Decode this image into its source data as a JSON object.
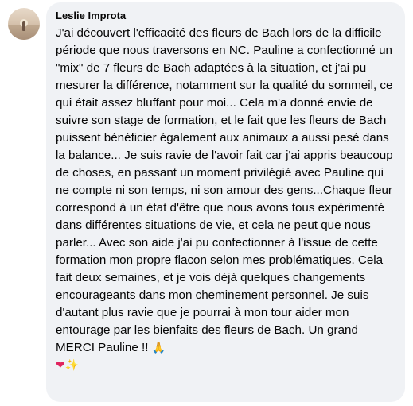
{
  "comment": {
    "author": "Leslie Improta",
    "text": "J'ai découvert l'efficacité des fleurs de Bach lors de la difficile période que nous traversons en NC. Pauline a confectionné un \"mix\" de 7 fleurs de Bach adaptées à la situation, et j'ai pu mesurer la différence, notamment sur la qualité du sommeil, ce qui était assez bluffant pour moi... Cela m'a donné envie de suivre son stage de formation, et le fait que les fleurs de Bach puissent bénéficier également aux animaux a aussi pesé dans la balance... Je suis ravie de l'avoir fait car j'ai appris beaucoup de choses, en passant un moment privilégié avec Pauline qui ne compte ni son temps, ni son amour des gens...Chaque fleur correspond à un état d'être que nous avons tous expérimenté dans différentes situations de vie, et cela ne peut que nous parler... Avec son aide j'ai pu confectionner à l'issue de cette formation mon propre flacon selon mes problématiques. Cela fait deux semaines, et je vois déjà quelques changements encourageants dans mon cheminement personnel. Je suis d'autant plus ravie que je pourrai à mon tour aider mon entourage par les bienfaits des fleurs de Bach. Un grand MERCI Pauline !!",
    "emojis": {
      "pray": "🙏",
      "heart": "❤",
      "sparkles": "✨"
    },
    "colors": {
      "bubble": "#f0f2f5",
      "text": "#050505"
    }
  }
}
